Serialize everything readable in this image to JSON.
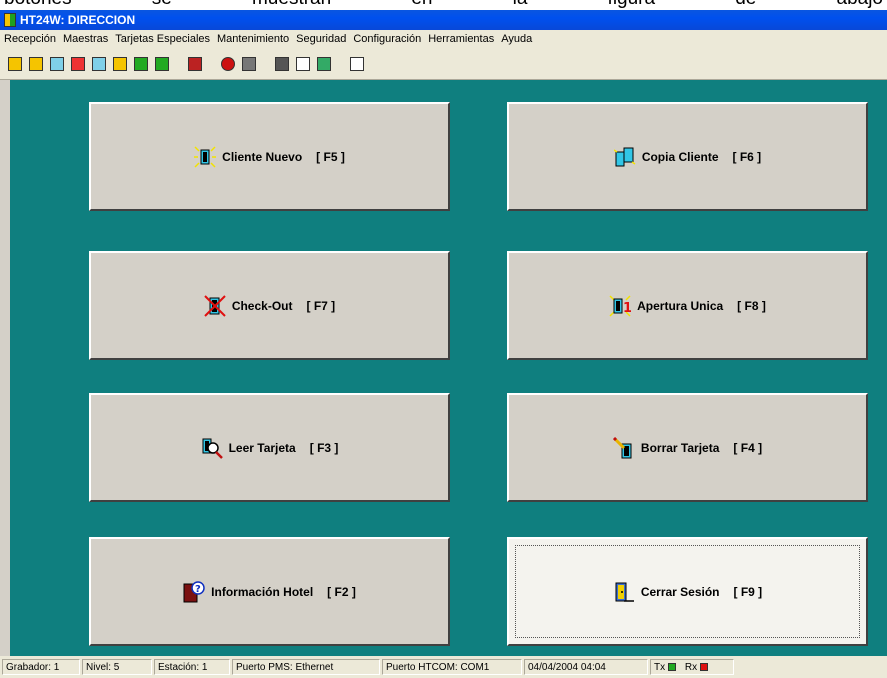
{
  "document_text": [
    "botones",
    "se",
    "muestran",
    "en",
    "la",
    "figura",
    "de",
    "abajo"
  ],
  "window": {
    "title": "HT24W: DIRECCION"
  },
  "menu": [
    "Recepción",
    "Maestras",
    "Tarjetas Especiales",
    "Mantenimiento",
    "Seguridad",
    "Configuración",
    "Herramientas",
    "Ayuda"
  ],
  "toolbar_icons": [
    "new-client-icon",
    "copy-client-icon",
    "checkout-icon",
    "single-opening-icon",
    "read-card-icon",
    "erase-card-icon",
    "special-card-icon",
    "card-icon",
    "gift-box-icon",
    "stop-icon",
    "audit-icon",
    "calculator-icon",
    "edit-icon",
    "card-reader-icon",
    "book-icon"
  ],
  "buttons": {
    "cliente_nuevo": {
      "label": "Cliente Nuevo",
      "key": "[ F5 ]"
    },
    "copia_cliente": {
      "label": "Copia Cliente",
      "key": "[ F6 ]"
    },
    "check_out": {
      "label": "Check-Out",
      "key": "[ F7 ]"
    },
    "apertura_unica": {
      "label": "Apertura Unica",
      "key": "[ F8 ]"
    },
    "leer_tarjeta": {
      "label": "Leer Tarjeta",
      "key": "[ F3 ]"
    },
    "borrar_tarjeta": {
      "label": "Borrar Tarjeta",
      "key": "[ F4 ]"
    },
    "informacion_hotel": {
      "label": "Información Hotel",
      "key": "[ F2 ]"
    },
    "cerrar_sesion": {
      "label": "Cerrar Sesión",
      "key": "[ F9 ]"
    }
  },
  "status": {
    "grabador": "Grabador: 1",
    "nivel": "Nivel: 5",
    "estacion": "Estación: 1",
    "puerto_pms": "Puerto PMS: Ethernet",
    "puerto_htcom": "Puerto HTCOM: COM1",
    "datetime": "04/04/2004  04:04",
    "tx": "Tx",
    "rx": "Rx"
  },
  "colors": {
    "background": "#0f7f7f",
    "button": "#d4d0c8",
    "button_active": "#f4f3ee",
    "tx_led": "#22aa22",
    "rx_led": "#dd1111"
  }
}
